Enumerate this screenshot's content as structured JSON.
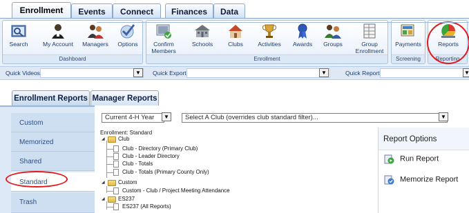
{
  "top_tabs": [
    "Enrollment",
    "Events",
    "Connect",
    "Finances",
    "Data"
  ],
  "ribbon": {
    "dashboard": {
      "label": "Dashboard",
      "buttons": [
        "Search",
        "My Account",
        "Managers",
        "Options"
      ]
    },
    "enrollment": {
      "label": "Enrollment",
      "buttons": [
        "Confirm Members",
        "Schools",
        "Clubs",
        "Activities",
        "Awards",
        "Groups",
        "Group Enrollment"
      ]
    },
    "screening": {
      "label": "Screening",
      "buttons": [
        "Payments"
      ]
    },
    "reporting": {
      "label": "Reporting",
      "buttons": [
        "Reports"
      ]
    }
  },
  "quick_bar": {
    "videos": "Quick Videos",
    "exports": "Quick Exports",
    "reports": "Quick Reports"
  },
  "report_tabs": [
    "Enrollment Reports",
    "Manager Reports"
  ],
  "side_nav": [
    "Custom",
    "Memorized",
    "Shared",
    "Standard",
    "Trash"
  ],
  "filters": {
    "year": "Current 4-H Year",
    "club": "Select A Club (overrides club standard filter)..."
  },
  "tree": {
    "root": "Enrollment: Standard",
    "folder_club": "Club",
    "club_items": [
      "Club - Directory (Primary Club)",
      "Club - Leader Directory",
      "Club - Totals",
      "Club - Totals (Primary County Only)"
    ],
    "folder_custom": "Custom",
    "custom_items": [
      "Custom - Club / Project Meeting Attendance"
    ],
    "folder_es237": "ES237",
    "es237_items": [
      "ES237 (All Reports)"
    ]
  },
  "report_options": {
    "title": "Report Options",
    "run": "Run Report",
    "memorize": "Memorize Report"
  },
  "colors": {
    "accent_ring": "#e3181b",
    "panel": "#dde9f6"
  }
}
